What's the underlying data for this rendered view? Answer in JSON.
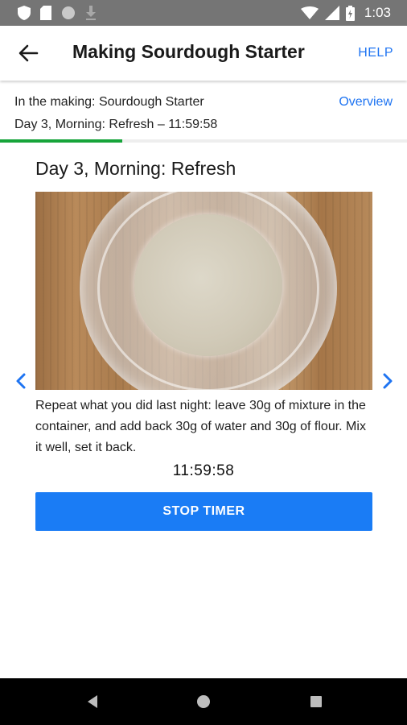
{
  "status_bar": {
    "time": "1:03",
    "icons": [
      "shield-icon",
      "sim-card-icon",
      "circle-icon",
      "download-icon",
      "wifi-icon",
      "signal-icon",
      "battery-icon"
    ]
  },
  "app_bar": {
    "title": "Making Sourdough Starter",
    "help_label": "HELP"
  },
  "progress_info": {
    "making_label": "In the making: Sourdough Starter",
    "overview_label": "Overview",
    "step_line": "Day 3, Morning: Refresh – 11:59:58",
    "progress_fraction": 0.3
  },
  "step": {
    "title": "Day 3, Morning: Refresh",
    "description": "Repeat what you did last night: leave 30g of mixture in the container, and add back 30g of water and 30g of flour. Mix it well, set it back.",
    "timer": "11:59:58",
    "stop_button_label": "STOP TIMER"
  },
  "colors": {
    "accent": "#1e74f2",
    "button": "#1a7cf5",
    "progress": "#16a43a",
    "status_bar": "#757575"
  }
}
